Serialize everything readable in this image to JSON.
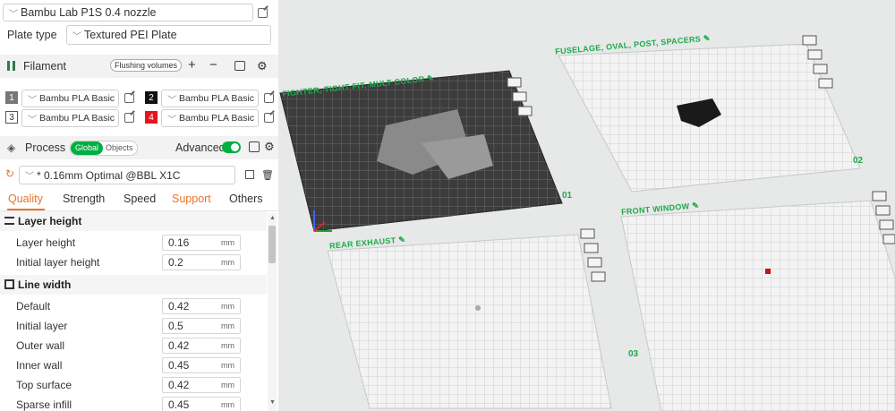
{
  "printer": {
    "name": "Bambu Lab P1S 0.4 nozzle"
  },
  "plate_type": {
    "label": "Plate type",
    "value": "Textured PEI Plate"
  },
  "filament": {
    "title": "Filament",
    "flushing_label": "Flushing volumes",
    "slots": [
      {
        "num": "1",
        "name": "Bambu PLA Basic",
        "color": "#777777"
      },
      {
        "num": "2",
        "name": "Bambu PLA Basic",
        "color": "#111111"
      },
      {
        "num": "3",
        "name": "Bambu PLA Basic",
        "color": "#ffffff"
      },
      {
        "num": "4",
        "name": "Bambu PLA Basic",
        "color": "#e3161c"
      }
    ]
  },
  "process": {
    "title": "Process",
    "scope_global": "Global",
    "scope_objects": "Objects",
    "advanced_label": "Advanced",
    "profile": "* 0.16mm Optimal @BBL X1C",
    "tabs": [
      "Quality",
      "Strength",
      "Speed",
      "Support",
      "Others"
    ],
    "groups": {
      "layer_height": {
        "title": "Layer height",
        "params": [
          {
            "label": "Layer height",
            "value": "0.16",
            "unit": "mm"
          },
          {
            "label": "Initial layer height",
            "value": "0.2",
            "unit": "mm"
          }
        ]
      },
      "line_width": {
        "title": "Line width",
        "params": [
          {
            "label": "Default",
            "value": "0.42",
            "unit": "mm"
          },
          {
            "label": "Initial layer",
            "value": "0.5",
            "unit": "mm"
          },
          {
            "label": "Outer wall",
            "value": "0.42",
            "unit": "mm"
          },
          {
            "label": "Inner wall",
            "value": "0.45",
            "unit": "mm"
          },
          {
            "label": "Top surface",
            "value": "0.42",
            "unit": "mm"
          },
          {
            "label": "Sparse infill",
            "value": "0.45",
            "unit": "mm"
          }
        ]
      }
    }
  },
  "plates": [
    {
      "label": "FIGHTER, TIGHT FIT, MULT COLOR",
      "num": "01"
    },
    {
      "label": "FUSELAGE, OVAL, POST, SPACERS",
      "num": "02"
    },
    {
      "label": "REAR EXHAUST",
      "num": "03"
    },
    {
      "label": "FRONT WINDOW",
      "num": ""
    }
  ],
  "colors": {
    "accent": "#00ae42",
    "support_tab": "#e8752f",
    "quality_tab": "#e8752f"
  }
}
